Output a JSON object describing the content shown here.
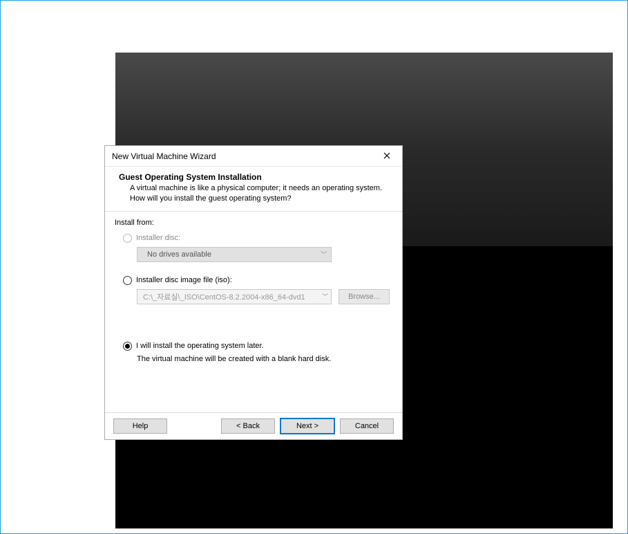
{
  "dialog": {
    "title": "New Virtual Machine Wizard",
    "header": {
      "title": "Guest Operating System Installation",
      "description": "A virtual machine is like a physical computer; it needs an operating system. How will you install the guest operating system?"
    },
    "body": {
      "section_label": "Install from:",
      "option_disc": {
        "label": "Installer disc:",
        "dropdown_value": "No drives available"
      },
      "option_iso": {
        "label": "Installer disc image file (iso):",
        "path": "C:\\_자료실\\_ISO\\CentOS-8.2.2004-x86_64-dvd1",
        "browse_label": "Browse..."
      },
      "option_later": {
        "label": "I will install the operating system later.",
        "description": "The virtual machine will be created with a blank hard disk."
      }
    },
    "footer": {
      "help": "Help",
      "back": "< Back",
      "next": "Next >",
      "cancel": "Cancel"
    }
  }
}
